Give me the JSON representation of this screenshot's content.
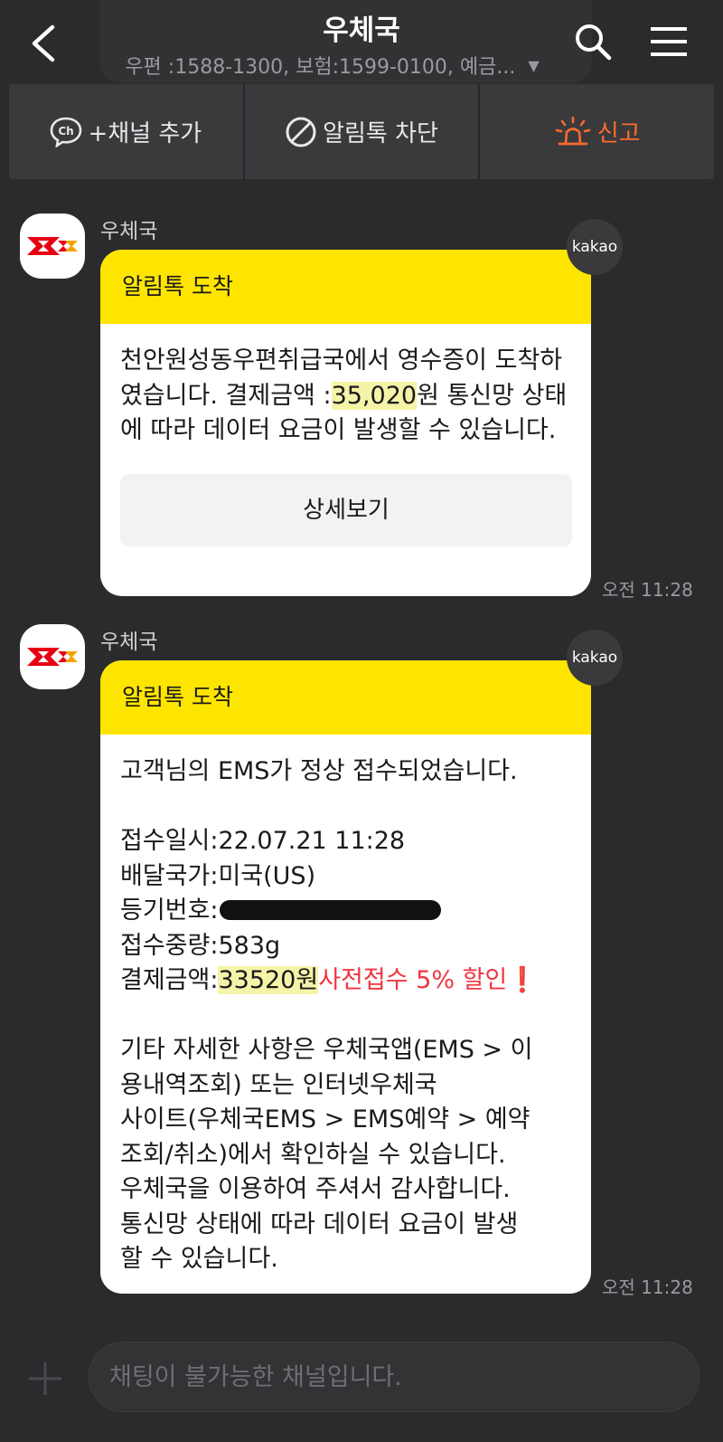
{
  "header": {
    "title": "우체국",
    "subtitle": "우편 :1588-1300, 보험:1599-0100, 예금..."
  },
  "actions": {
    "add_channel": "+채널 추가",
    "block": "알림톡 차단",
    "report": "신고"
  },
  "colors": {
    "background": "#2b2b2d",
    "header_yellow": "#fee500",
    "report_orange": "#ff6b2c",
    "highlight": "#f4f3a8",
    "red_text": "#f03640"
  },
  "messages": [
    {
      "sender": "우체국",
      "badge": "kakao",
      "header": "알림톡 도착",
      "text_before": "천안원성동우편취급국에서 영수증이 도착하였습니다. 결제금액 :",
      "amount": "35,020",
      "text_after": "원 통신망 상태에 따라 데이터 요금이 발생할 수 있습니다.",
      "button": "상세보기",
      "time": "오전 11:28"
    },
    {
      "sender": "우체국",
      "badge": "kakao",
      "header": "알림톡 도착",
      "intro": "고객님의 EMS가 정상 접수되었습니다.",
      "lines": {
        "date": "접수일시:22.07.21 11:28",
        "country": "배달국가:미국(US)",
        "reg_label": "등기번호:",
        "weight": "접수중량:583g",
        "pay_label": "결제금액:",
        "pay_amount": "33520원",
        "discount": "사전접수 5% 할인",
        "discount_icon": "❗"
      },
      "outro": [
        "기타 자세한 사항은 우체국앱(EMS > 이",
        "용내역조회) 또는 인터넷우체국",
        "사이트(우체국EMS > EMS예약 > 예약",
        "조회/취소)에서 확인하실 수 있습니다.",
        "우체국을 이용하여 주셔서 감사합니다.",
        "통신망 상태에 따라 데이터 요금이 발생",
        "할 수 있습니다."
      ],
      "time": "오전 11:28"
    }
  ],
  "input": {
    "placeholder": "채팅이 불가능한 채널입니다."
  }
}
